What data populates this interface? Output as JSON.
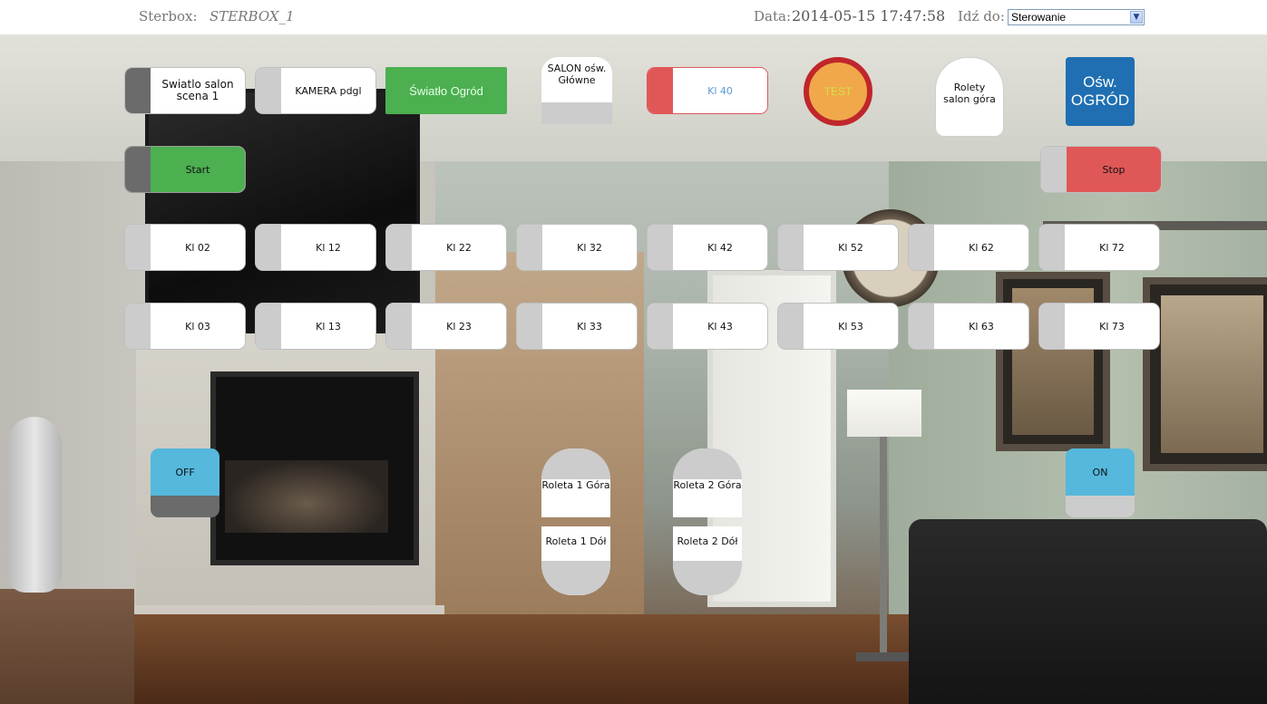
{
  "header": {
    "app_label": "Sterbox:",
    "device_name": "STERBOX_1",
    "date_label": "Data:",
    "date_value": "2014-05-15 17:47:58",
    "goto_label": "Idź do:",
    "goto_selected": "Sterowanie"
  },
  "buttons": {
    "swiatlo_salon": "Swiatlo salon scena 1",
    "kamera": "KAMERA pdgl",
    "swiatlo_ogrod": "Światło Ogród",
    "salon_osw": "SALON ośw. Główne",
    "kl40": "Kl 40",
    "test": "TEST",
    "rolety_salon": "Rolety salon góra",
    "osw_ogrod": "Ośw. OGRÓD",
    "start": "Start",
    "stop": "Stop",
    "off": "OFF",
    "on": "ON",
    "roleta1_gora": "Roleta 1 Góra",
    "roleta1_dol": "Roleta 1 Dół",
    "roleta2_gora": "Roleta 2 Góra",
    "roleta2_dol": "Roleta 2 Dół"
  },
  "row2": [
    "Kl 02",
    "Kl 12",
    "Kl 22",
    "Kl 32",
    "Kl 42",
    "Kl 52",
    "Kl 62",
    "Kl 72"
  ],
  "row3": [
    "Kl 03",
    "Kl 13",
    "Kl 23",
    "Kl 33",
    "Kl 43",
    "Kl 53",
    "Kl 63",
    "Kl 73"
  ],
  "colors": {
    "green": "#4caf50",
    "red": "#e05757",
    "blue_tile": "#1f6fb2",
    "cyan": "#55b8dc",
    "test_fill": "#f0a84a",
    "test_ring": "#c0262b"
  }
}
